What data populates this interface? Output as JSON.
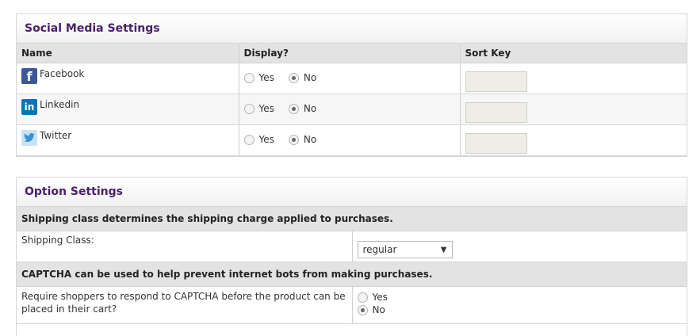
{
  "social": {
    "title": "Social Media Settings",
    "columns": [
      "Name",
      "Display?",
      "Sort Key"
    ],
    "networks": [
      {
        "name": "Facebook",
        "icon": "facebook-icon",
        "yes": "Yes",
        "no": "No",
        "selected": "No",
        "sort_key": ""
      },
      {
        "name": "Linkedin",
        "icon": "linkedin-icon",
        "yes": "Yes",
        "no": "No",
        "selected": "No",
        "sort_key": ""
      },
      {
        "name": "Twitter",
        "icon": "twitter-icon",
        "yes": "Yes",
        "no": "No",
        "selected": "No",
        "sort_key": ""
      }
    ]
  },
  "options": {
    "title": "Option Settings",
    "shipping_note": "Shipping class determines the shipping charge applied to purchases.",
    "shipping_label": "Shipping Class:",
    "shipping_value": "regular",
    "captcha_note": "CAPTCHA can be used to help prevent internet bots from making purchases.",
    "captcha_label": "Require shoppers to respond to CAPTCHA before the product can be placed in their cart?",
    "captcha_yes": "Yes",
    "captcha_no": "No",
    "captcha_selected": "No"
  },
  "colors": {
    "heading": "#4a1f6b",
    "facebook": "#3b5998",
    "linkedin": "#0077b5"
  }
}
